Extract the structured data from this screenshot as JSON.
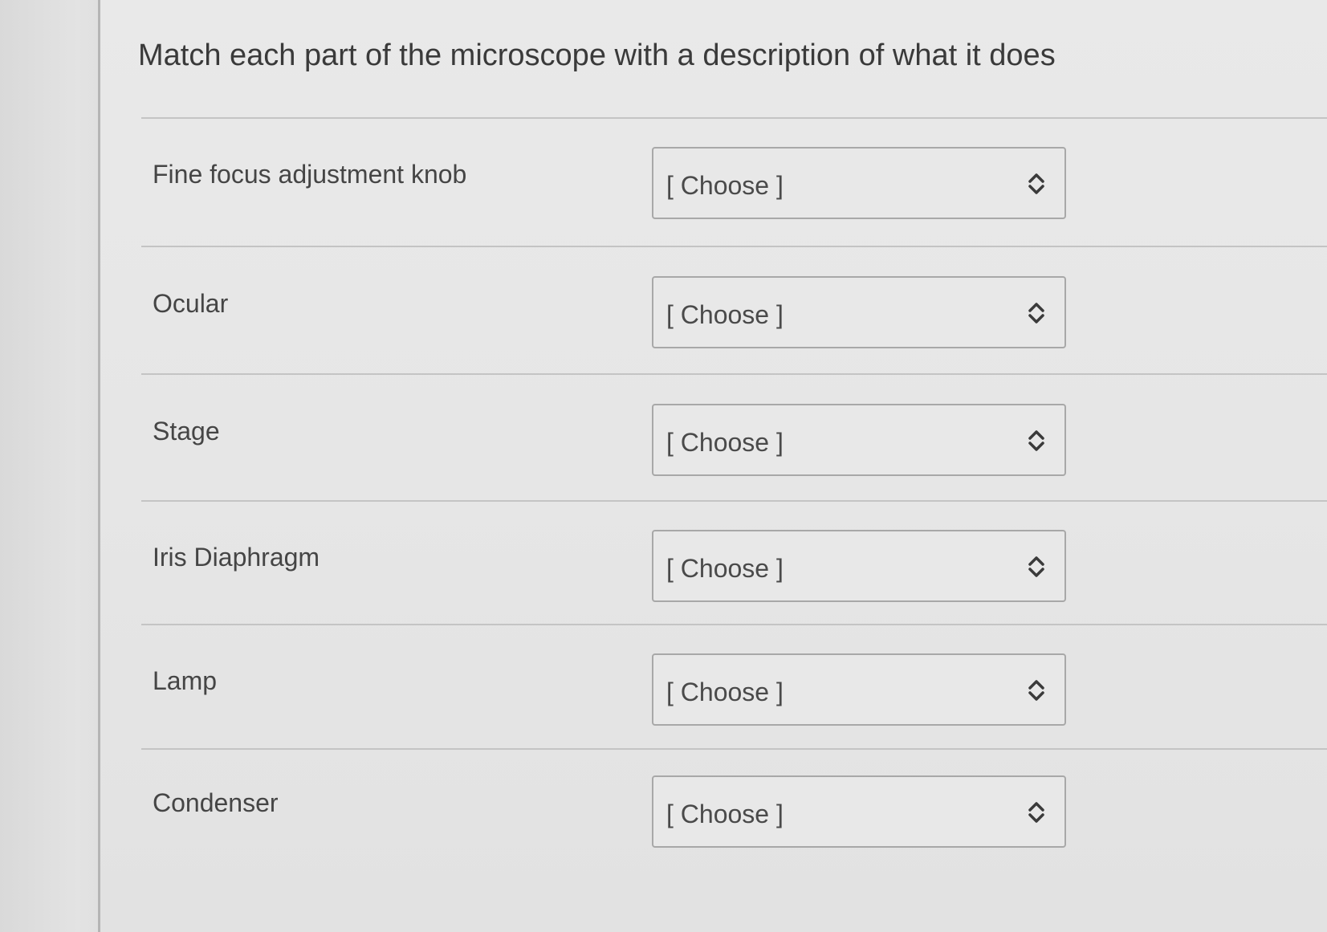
{
  "question": {
    "title": "Match each part of the microscope with a description of what it does"
  },
  "rows": [
    {
      "label": "Fine focus adjustment knob",
      "selected": "[ Choose ]"
    },
    {
      "label": "Ocular",
      "selected": "[ Choose ]"
    },
    {
      "label": "Stage",
      "selected": "[ Choose ]"
    },
    {
      "label": "Iris Diaphragm",
      "selected": "[ Choose ]"
    },
    {
      "label": "Lamp",
      "selected": "[ Choose ]"
    },
    {
      "label": "Condenser",
      "selected": "[ Choose ]"
    }
  ],
  "icons": {
    "select_indicator": "chevron-up-down-icon"
  },
  "colors": {
    "background": "#e6e6e6",
    "text": "#3d3d3d",
    "border": "#a8a8a8"
  }
}
